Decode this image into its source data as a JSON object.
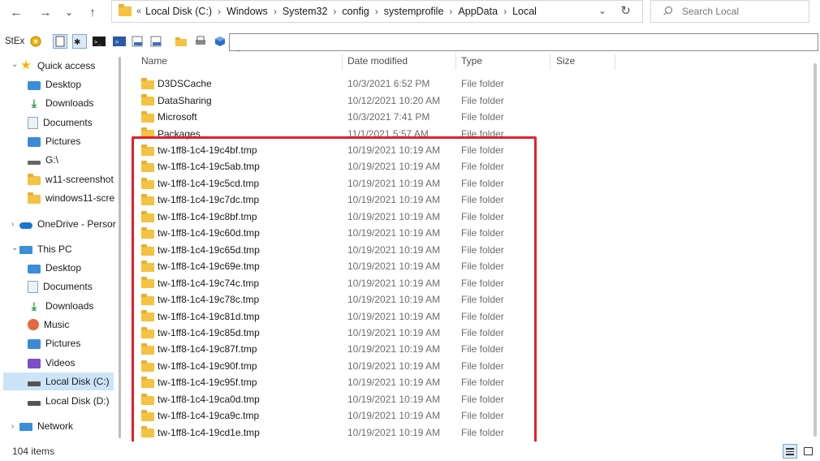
{
  "nav": {
    "back": "←",
    "forward": "→",
    "recent": "⌄",
    "up": "↑"
  },
  "address": {
    "overflow": "«",
    "crumbs": [
      "Local Disk (C:)",
      "Windows",
      "System32",
      "config",
      "systemprofile",
      "AppData",
      "Local"
    ],
    "separator": "›",
    "dropdown": "⌄",
    "refresh": "↻"
  },
  "search": {
    "placeholder": "Search Local"
  },
  "toolbar": {
    "label": "StEx"
  },
  "sidebar": {
    "quick_access": "Quick access",
    "quick_items": [
      {
        "label": "Desktop",
        "pinned": true,
        "icon": "desktop-icon"
      },
      {
        "label": "Downloads",
        "pinned": true,
        "icon": "downloads-icon"
      },
      {
        "label": "Documents",
        "pinned": true,
        "icon": "documents-icon"
      },
      {
        "label": "Pictures",
        "pinned": true,
        "icon": "pictures-icon"
      },
      {
        "label": "G:\\",
        "pinned": false,
        "icon": "drive-icon"
      },
      {
        "label": "w11-screenshot",
        "pinned": false,
        "icon": "folder-icon"
      },
      {
        "label": "windows11-scre",
        "pinned": false,
        "icon": "folder-icon"
      }
    ],
    "onedrive": "OneDrive - Persor",
    "this_pc": "This PC",
    "pc_items": [
      {
        "label": "Desktop",
        "icon": "desktop-icon"
      },
      {
        "label": "Documents",
        "icon": "documents-icon"
      },
      {
        "label": "Downloads",
        "icon": "downloads-icon"
      },
      {
        "label": "Music",
        "icon": "music-icon"
      },
      {
        "label": "Pictures",
        "icon": "pictures-icon"
      },
      {
        "label": "Videos",
        "icon": "videos-icon"
      },
      {
        "label": "Local Disk (C:)",
        "icon": "local-disk-icon",
        "selected": true
      },
      {
        "label": "Local Disk (D:)",
        "icon": "local-disk-icon"
      }
    ],
    "network": "Network"
  },
  "columns": {
    "name": "Name",
    "date": "Date modified",
    "type": "Type",
    "size": "Size"
  },
  "files": [
    {
      "name": "D3DSCache",
      "date": "10/3/2021 6:52 PM",
      "type": "File folder"
    },
    {
      "name": "DataSharing",
      "date": "10/12/2021 10:20 AM",
      "type": "File folder"
    },
    {
      "name": "Microsoft",
      "date": "10/3/2021 7:41 PM",
      "type": "File folder"
    },
    {
      "name": "Packages",
      "date": "11/1/2021 5:57 AM",
      "type": "File folder"
    },
    {
      "name": "tw-1ff8-1c4-19c4bf.tmp",
      "date": "10/19/2021 10:19 AM",
      "type": "File folder"
    },
    {
      "name": "tw-1ff8-1c4-19c5ab.tmp",
      "date": "10/19/2021 10:19 AM",
      "type": "File folder"
    },
    {
      "name": "tw-1ff8-1c4-19c5cd.tmp",
      "date": "10/19/2021 10:19 AM",
      "type": "File folder"
    },
    {
      "name": "tw-1ff8-1c4-19c7dc.tmp",
      "date": "10/19/2021 10:19 AM",
      "type": "File folder"
    },
    {
      "name": "tw-1ff8-1c4-19c8bf.tmp",
      "date": "10/19/2021 10:19 AM",
      "type": "File folder"
    },
    {
      "name": "tw-1ff8-1c4-19c60d.tmp",
      "date": "10/19/2021 10:19 AM",
      "type": "File folder"
    },
    {
      "name": "tw-1ff8-1c4-19c65d.tmp",
      "date": "10/19/2021 10:19 AM",
      "type": "File folder"
    },
    {
      "name": "tw-1ff8-1c4-19c69e.tmp",
      "date": "10/19/2021 10:19 AM",
      "type": "File folder"
    },
    {
      "name": "tw-1ff8-1c4-19c74c.tmp",
      "date": "10/19/2021 10:19 AM",
      "type": "File folder"
    },
    {
      "name": "tw-1ff8-1c4-19c78c.tmp",
      "date": "10/19/2021 10:19 AM",
      "type": "File folder"
    },
    {
      "name": "tw-1ff8-1c4-19c81d.tmp",
      "date": "10/19/2021 10:19 AM",
      "type": "File folder"
    },
    {
      "name": "tw-1ff8-1c4-19c85d.tmp",
      "date": "10/19/2021 10:19 AM",
      "type": "File folder"
    },
    {
      "name": "tw-1ff8-1c4-19c87f.tmp",
      "date": "10/19/2021 10:19 AM",
      "type": "File folder"
    },
    {
      "name": "tw-1ff8-1c4-19c90f.tmp",
      "date": "10/19/2021 10:19 AM",
      "type": "File folder"
    },
    {
      "name": "tw-1ff8-1c4-19c95f.tmp",
      "date": "10/19/2021 10:19 AM",
      "type": "File folder"
    },
    {
      "name": "tw-1ff8-1c4-19ca0d.tmp",
      "date": "10/19/2021 10:19 AM",
      "type": "File folder"
    },
    {
      "name": "tw-1ff8-1c4-19ca9c.tmp",
      "date": "10/19/2021 10:19 AM",
      "type": "File folder"
    },
    {
      "name": "tw-1ff8-1c4-19cd1e.tmp",
      "date": "10/19/2021 10:19 AM",
      "type": "File folder"
    }
  ],
  "status": {
    "item_count": "104 items"
  },
  "colors": {
    "highlight": "#e1202a",
    "selected": "#cce4f7",
    "folder": "#f5c242"
  }
}
